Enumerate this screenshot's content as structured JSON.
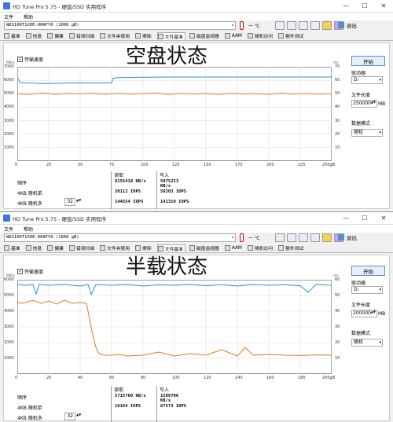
{
  "windows": [
    {
      "title": "HD Tune Pro 5.75 - 硬盘/SSD 实用程序",
      "menu": [
        "文件",
        "帮助"
      ],
      "drive": "WDS100T1X0E-00AFY0 (1000 gB)",
      "temperature": "一 ℃",
      "exit_label": "退出",
      "tabs": [
        "基准",
        "信息",
        "健康",
        "错误扫描",
        "文件夹使用",
        "擦除",
        "文件基准",
        "磁盘监视器",
        "AAM",
        "随机访问",
        "额外测试"
      ],
      "active_tab": "文件基准",
      "transfer_speed_label": "传输速度",
      "heading": "空盘状态",
      "left_unit": "MB/s",
      "right_unit": "ms",
      "left_ticks": [
        "7000",
        "6000",
        "5000",
        "4000",
        "3000",
        "2000",
        "1000"
      ],
      "right_ticks": [
        "70",
        "60",
        "50",
        "40",
        "30",
        "20",
        "10"
      ],
      "x_ticks": [
        "0",
        "25",
        "50",
        "75",
        "100",
        "125",
        "150",
        "175",
        "200",
        "225",
        "250gB"
      ],
      "start_label": "开始",
      "drive_letter_label": "驱动器",
      "drive_letter": "D:",
      "file_length_label": "文件长度",
      "file_length": "250000",
      "file_length_unit": "MB",
      "data_mode_label": "数据模式",
      "data_mode": "随机",
      "results": {
        "read_header": "读取",
        "write_header": "写入",
        "rows": [
          {
            "label": "顺序",
            "read": "6255418 KB/s",
            "write": "5075223 KB/s"
          },
          {
            "label": "4KB 随机单",
            "read": "20112 IOPS",
            "write": "58203 IOPS"
          },
          {
            "label": "4KB 随机多",
            "read": "144554 IOPS",
            "write": "141319 IOPS"
          }
        ],
        "queue_depth": "32"
      },
      "chart_data": {
        "type": "line",
        "xlabel": "",
        "xlim": [
          0,
          250
        ],
        "y_left_lim": [
          0,
          7000
        ],
        "y_right_lim": [
          0,
          70
        ],
        "series": [
          {
            "color": "#2b8fd6",
            "x": [
              0,
              2,
              5,
              10,
              20,
              40,
              60,
              70,
              75,
              76,
              80,
              100,
              125,
              150,
              175,
              200,
              225,
              250
            ],
            "values": [
              6200,
              5850,
              5800,
              5800,
              5750,
              5800,
              5800,
              5800,
              5800,
              6150,
              6200,
              6230,
              6240,
              6240,
              6240,
              6240,
              6240,
              6240
            ]
          },
          {
            "color": "#e07a1f",
            "x": [
              0,
              10,
              20,
              30,
              40,
              50,
              60,
              70,
              80,
              90,
              100,
              110,
              120,
              130,
              140,
              150,
              160,
              170,
              180,
              190,
              200,
              210,
              220,
              230,
              240,
              250
            ],
            "values": [
              5000,
              4950,
              5050,
              4950,
              5020,
              4980,
              5040,
              4960,
              5030,
              4970,
              5010,
              5050,
              4960,
              5020,
              4980,
              5030,
              4950,
              5040,
              4990,
              5010,
              4960,
              5040,
              4980,
              5020,
              4970,
              5000
            ]
          }
        ]
      }
    },
    {
      "title": "HD Tune Pro 5.75 - 硬盘/SSD 实用程序",
      "menu": [
        "文件",
        "帮助"
      ],
      "drive": "WDS100T1X0E-00AFY0 (1000 gB)",
      "temperature": "一 ℃",
      "exit_label": "退出",
      "tabs": [
        "基准",
        "信息",
        "健康",
        "错误扫描",
        "文件夹使用",
        "擦除",
        "文件基准",
        "磁盘监视器",
        "AAM",
        "随机访问",
        "额外测试"
      ],
      "active_tab": "文件基准",
      "transfer_speed_label": "传输速度",
      "heading": "半载状态",
      "left_unit": "MB/s",
      "right_unit": "ms",
      "left_ticks": [
        "6000",
        "5000",
        "4000",
        "3000",
        "2000",
        "1000"
      ],
      "right_ticks": [
        "60",
        "50",
        "40",
        "30",
        "20",
        "10"
      ],
      "x_ticks": [
        "0",
        "20",
        "40",
        "60",
        "80",
        "100",
        "120",
        "140",
        "160",
        "180",
        "200gB"
      ],
      "start_label": "开始",
      "drive_letter_label": "驱动器",
      "drive_letter": "D:",
      "file_length_label": "文件长度",
      "file_length": "200000",
      "file_length_unit": "MB",
      "data_mode_label": "数据模式",
      "data_mode": "随机",
      "results": {
        "read_header": "读取",
        "write_header": "写入",
        "rows": [
          {
            "label": "顺序",
            "read": "5715760 KB/s",
            "write": "1509706 KB/s"
          },
          {
            "label": "4KB 随机单",
            "read": "16164 IOPS",
            "write": "67573 IOPS"
          },
          {
            "label": "4KB 随机多",
            "read": "",
            "write": ""
          }
        ],
        "queue_depth": "32"
      },
      "chart_data": {
        "type": "line",
        "xlabel": "",
        "xlim": [
          0,
          200
        ],
        "y_left_lim": [
          0,
          6000
        ],
        "y_right_lim": [
          0,
          60
        ],
        "series": [
          {
            "color": "#2b8fd6",
            "x": [
              0,
              5,
              10,
              12,
              14,
              20,
              30,
              40,
              45,
              47,
              50,
              60,
              70,
              80,
              90,
              100,
              110,
              120,
              130,
              140,
              150,
              160,
              170,
              180,
              185,
              190,
              200
            ],
            "values": [
              5700,
              5650,
              5700,
              5100,
              5700,
              5650,
              5700,
              5600,
              5700,
              5050,
              5700,
              5650,
              5700,
              5600,
              5680,
              5650,
              5700,
              5620,
              5690,
              5600,
              5700,
              5650,
              5680,
              5620,
              5200,
              5700,
              5650
            ]
          },
          {
            "color": "#e07a1f",
            "x": [
              0,
              2,
              5,
              10,
              15,
              20,
              25,
              30,
              35,
              40,
              44,
              46,
              48,
              50,
              52,
              55,
              60,
              65,
              70,
              80,
              90,
              100,
              110,
              120,
              130,
              140,
              145,
              150,
              160,
              170,
              180,
              190,
              200
            ],
            "values": [
              4600,
              4500,
              4550,
              4700,
              4500,
              4650,
              4450,
              4700,
              4500,
              4550,
              4500,
              3500,
              2500,
              1700,
              1300,
              1200,
              1200,
              1250,
              1150,
              1200,
              1400,
              1150,
              1300,
              1200,
              1550,
              1150,
              1700,
              1200,
              1250,
              1200,
              1180,
              1220,
              1200
            ]
          }
        ]
      }
    }
  ]
}
